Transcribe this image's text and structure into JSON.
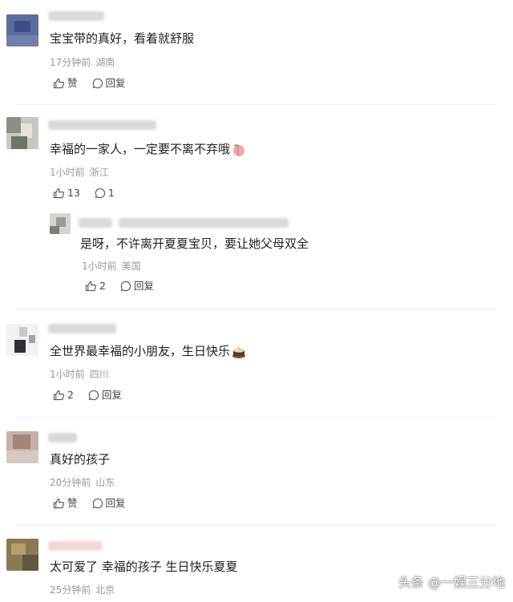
{
  "comments": [
    {
      "text": "宝宝带的真好，看着就舒服",
      "time": "17分钟前",
      "location": "湖南",
      "like": "赞",
      "reply": "回复"
    },
    {
      "text": "幸福的一家人，一定要不离不弃哦",
      "time": "1小时前",
      "location": "浙江",
      "like": "13",
      "reply": "1"
    },
    {
      "text": "是呀，不许离开夏夏宝贝，要让她父母双全",
      "time": "1小时前",
      "location": "美国",
      "like": "2",
      "reply": "回复"
    },
    {
      "text": "全世界最幸福的小朋友，生日快乐",
      "time": "1小时前",
      "location": "四川",
      "like": "2",
      "reply": "回复"
    },
    {
      "text": "真好的孩子",
      "time": "20分钟前",
      "location": "山东",
      "like": "赞",
      "reply": "回复"
    },
    {
      "text": "太可爱了 幸福的孩子 生日快乐夏夏",
      "time": "25分钟前",
      "location": "北京"
    }
  ],
  "watermark": "头条 @一娱三分地",
  "icons": {
    "like": "thumbs-up-icon",
    "reply": "reply-bubble-icon",
    "peach": "peach-emoji-icon",
    "cake": "cake-emoji-icon"
  }
}
